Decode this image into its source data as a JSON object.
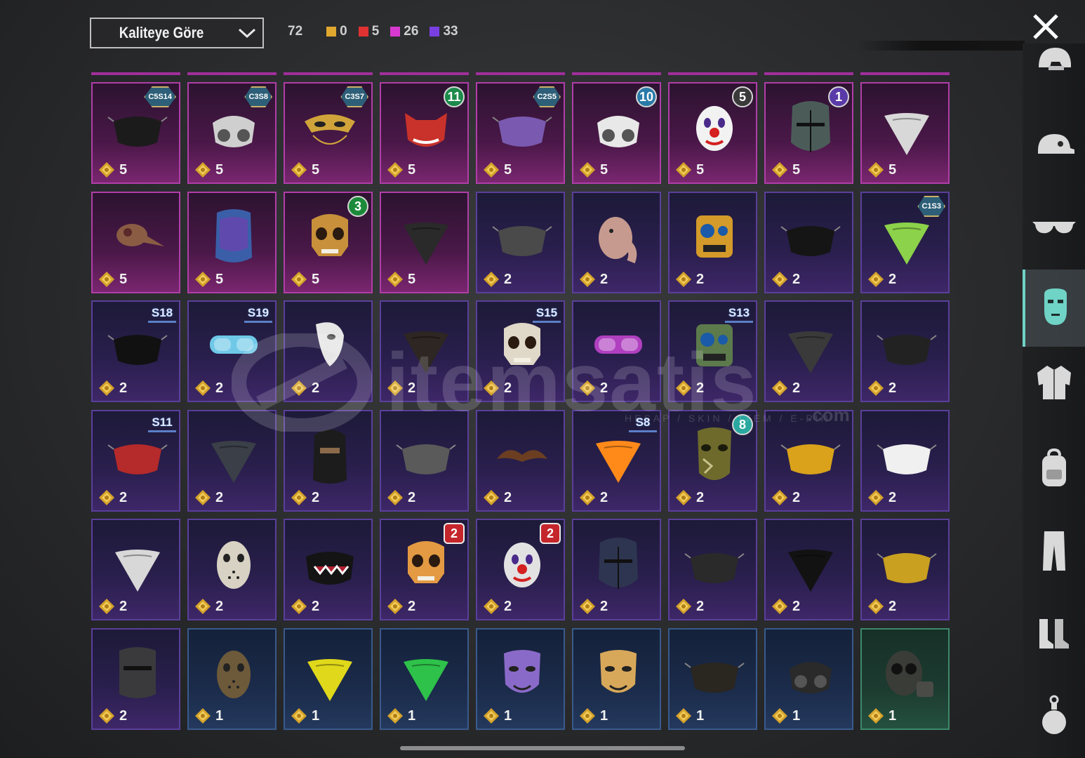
{
  "sort": {
    "label": "Kaliteye Göre"
  },
  "summary": {
    "total": "72",
    "counts": [
      {
        "color": "#e0a82e",
        "value": "0"
      },
      {
        "color": "#e03232",
        "value": "5"
      },
      {
        "color": "#d83ad0",
        "value": "26"
      },
      {
        "color": "#7a3fe0",
        "value": "33"
      }
    ]
  },
  "sidebar": {
    "tabs": [
      {
        "name": "helmet-icon",
        "active": false
      },
      {
        "name": "cap-icon",
        "active": false
      },
      {
        "name": "glasses-icon",
        "active": false
      },
      {
        "name": "mask-icon",
        "active": true
      },
      {
        "name": "jacket-icon",
        "active": false
      },
      {
        "name": "backpack-icon",
        "active": false
      },
      {
        "name": "pants-icon",
        "active": false
      },
      {
        "name": "boots-icon",
        "active": false
      },
      {
        "name": "grenade-icon",
        "active": false
      }
    ]
  },
  "watermark": {
    "text": "itemsatis",
    "sub": "HESAP / SKIN / ITEM / E-PIN",
    "domain": ".com"
  },
  "items": [
    {
      "rarity": "pink",
      "qty": "5",
      "badge": "C5S14",
      "badge_type": "hex",
      "art": "mask-cloth",
      "color": "#1b1b1b"
    },
    {
      "rarity": "pink",
      "qty": "5",
      "badge": "C3S8",
      "badge_type": "hex",
      "art": "respirator",
      "color": "#cfcfcf"
    },
    {
      "rarity": "pink",
      "qty": "5",
      "badge": "C3S7",
      "badge_type": "hex",
      "art": "venetian",
      "color": "#d0a43a"
    },
    {
      "rarity": "pink",
      "qty": "5",
      "badge": "11",
      "badge_type": "circle",
      "art": "oni",
      "color": "#c8322a"
    },
    {
      "rarity": "pink",
      "qty": "5",
      "badge": "C2S5",
      "badge_type": "hex",
      "art": "mask-cloth",
      "color": "#7a5ab0"
    },
    {
      "rarity": "pink",
      "qty": "5",
      "badge": "10",
      "badge_type": "circle",
      "art": "respirator",
      "color": "#e8e8e8"
    },
    {
      "rarity": "pink",
      "qty": "5",
      "badge": "5",
      "badge_type": "circle",
      "art": "clown",
      "color": "#f2f2f2"
    },
    {
      "rarity": "pink",
      "qty": "5",
      "badge": "1",
      "badge_type": "circle",
      "art": "knight",
      "color": "#4b5c58"
    },
    {
      "rarity": "pink",
      "qty": "5",
      "badge": "",
      "badge_type": "",
      "art": "bandana",
      "color": "#d8d8d8"
    },
    {
      "rarity": "pink",
      "qty": "5",
      "badge": "",
      "badge_type": "",
      "art": "plague",
      "color": "#8a5c44"
    },
    {
      "rarity": "pink",
      "qty": "5",
      "badge": "",
      "badge_type": "",
      "art": "visor",
      "color": "#3a5fa8"
    },
    {
      "rarity": "pink",
      "qty": "5",
      "badge": "3",
      "badge_type": "circle",
      "art": "skull",
      "color": "#c8903a"
    },
    {
      "rarity": "pink",
      "qty": "5",
      "badge": "",
      "badge_type": "",
      "art": "bandana",
      "color": "#2a2a2a"
    },
    {
      "rarity": "purple",
      "qty": "2",
      "badge": "",
      "badge_type": "",
      "art": "mask-cloth",
      "color": "#4a4a4a"
    },
    {
      "rarity": "purple",
      "qty": "2",
      "badge": "",
      "badge_type": "",
      "art": "animal",
      "color": "#c69a8e"
    },
    {
      "rarity": "purple",
      "qty": "2",
      "badge": "",
      "badge_type": "",
      "art": "robot",
      "color": "#d49a2a"
    },
    {
      "rarity": "purple",
      "qty": "2",
      "badge": "",
      "badge_type": "",
      "art": "mask-cloth",
      "color": "#151515"
    },
    {
      "rarity": "purple",
      "qty": "2",
      "badge": "C1S3",
      "badge_type": "hex",
      "art": "bandana",
      "color": "#8cd24a"
    },
    {
      "rarity": "purple",
      "qty": "2",
      "badge": "S18",
      "badge_type": "wing",
      "art": "mask-cloth",
      "color": "#111111"
    },
    {
      "rarity": "purple",
      "qty": "2",
      "badge": "S19",
      "badge_type": "wing",
      "art": "goggles",
      "color": "#6fc8e8"
    },
    {
      "rarity": "purple",
      "qty": "2",
      "badge": "",
      "badge_type": "",
      "art": "phantom",
      "color": "#e6e6e6"
    },
    {
      "rarity": "purple",
      "qty": "2",
      "badge": "",
      "badge_type": "",
      "art": "bandana",
      "color": "#2d2622"
    },
    {
      "rarity": "purple",
      "qty": "2",
      "badge": "S15",
      "badge_type": "wing",
      "art": "skull",
      "color": "#e0d8c8"
    },
    {
      "rarity": "purple",
      "qty": "2",
      "badge": "",
      "badge_type": "",
      "art": "goggles",
      "color": "#b040c0"
    },
    {
      "rarity": "purple",
      "qty": "2",
      "badge": "S13",
      "badge_type": "wing",
      "art": "robot",
      "color": "#5c7a4c"
    },
    {
      "rarity": "purple",
      "qty": "2",
      "badge": "",
      "badge_type": "",
      "art": "bandana",
      "color": "#3a3a3a"
    },
    {
      "rarity": "purple",
      "qty": "2",
      "badge": "",
      "badge_type": "",
      "art": "mask-cloth",
      "color": "#222222"
    },
    {
      "rarity": "purple",
      "qty": "2",
      "badge": "S11",
      "badge_type": "wing",
      "art": "mask-cloth",
      "color": "#b52a2a"
    },
    {
      "rarity": "purple",
      "qty": "2",
      "badge": "",
      "badge_type": "",
      "art": "bandana",
      "color": "#3a3f48"
    },
    {
      "rarity": "purple",
      "qty": "2",
      "badge": "",
      "badge_type": "",
      "art": "balaclava",
      "color": "#1c1c1c"
    },
    {
      "rarity": "purple",
      "qty": "2",
      "badge": "",
      "badge_type": "",
      "art": "mask-cloth",
      "color": "#5a5a5a"
    },
    {
      "rarity": "purple",
      "qty": "2",
      "badge": "",
      "badge_type": "",
      "art": "mustache",
      "color": "#6b3e22"
    },
    {
      "rarity": "purple",
      "qty": "2",
      "badge": "S8",
      "badge_type": "wing",
      "art": "bandana",
      "color": "#ff8a1a"
    },
    {
      "rarity": "purple",
      "qty": "2",
      "badge": "8",
      "badge_type": "circle",
      "art": "camo",
      "color": "#6e6a2c"
    },
    {
      "rarity": "purple",
      "qty": "2",
      "badge": "",
      "badge_type": "",
      "art": "mask-cloth",
      "color": "#d9a21a"
    },
    {
      "rarity": "purple",
      "qty": "2",
      "badge": "",
      "badge_type": "",
      "art": "mask-cloth",
      "color": "#f0f0f0"
    },
    {
      "rarity": "purple",
      "qty": "2",
      "badge": "",
      "badge_type": "",
      "art": "bandana",
      "color": "#d8d8d8"
    },
    {
      "rarity": "purple",
      "qty": "2",
      "badge": "",
      "badge_type": "",
      "art": "hockey",
      "color": "#d8d2c4"
    },
    {
      "rarity": "purple",
      "qty": "2",
      "badge": "",
      "badge_type": "",
      "art": "teeth",
      "color": "#141414"
    },
    {
      "rarity": "purple",
      "qty": "2",
      "badge": "2",
      "badge_type": "red2",
      "art": "skull",
      "color": "#e39a42"
    },
    {
      "rarity": "purple",
      "qty": "2",
      "badge": "2",
      "badge_type": "red2",
      "art": "clown",
      "color": "#e2e2e2"
    },
    {
      "rarity": "purple",
      "qty": "2",
      "badge": "",
      "badge_type": "",
      "art": "knight",
      "color": "#2e3550"
    },
    {
      "rarity": "purple",
      "qty": "2",
      "badge": "",
      "badge_type": "",
      "art": "mask-cloth",
      "color": "#2a2a2a"
    },
    {
      "rarity": "purple",
      "qty": "2",
      "badge": "",
      "badge_type": "",
      "art": "bandana",
      "color": "#121212"
    },
    {
      "rarity": "purple",
      "qty": "2",
      "badge": "",
      "badge_type": "",
      "art": "mask-cloth",
      "color": "#c9a020"
    },
    {
      "rarity": "purple",
      "qty": "2",
      "badge": "",
      "badge_type": "",
      "art": "riot",
      "color": "#3a3a3c"
    },
    {
      "rarity": "blue",
      "qty": "1",
      "badge": "",
      "badge_type": "",
      "art": "hockey",
      "color": "#6d5a3a"
    },
    {
      "rarity": "blue",
      "qty": "1",
      "badge": "",
      "badge_type": "",
      "art": "bandana",
      "color": "#e0d81a"
    },
    {
      "rarity": "blue",
      "qty": "1",
      "badge": "",
      "badge_type": "",
      "art": "bandana",
      "color": "#2ec24a"
    },
    {
      "rarity": "blue",
      "qty": "1",
      "badge": "",
      "badge_type": "",
      "art": "theater",
      "color": "#8a6ac8"
    },
    {
      "rarity": "blue",
      "qty": "1",
      "badge": "",
      "badge_type": "",
      "art": "theater",
      "color": "#d8a85a"
    },
    {
      "rarity": "blue",
      "qty": "1",
      "badge": "",
      "badge_type": "",
      "art": "mask-cloth",
      "color": "#2a2620"
    },
    {
      "rarity": "blue",
      "qty": "1",
      "badge": "",
      "badge_type": "",
      "art": "respirator",
      "color": "#2a2a2a"
    },
    {
      "rarity": "green",
      "qty": "1",
      "badge": "",
      "badge_type": "",
      "art": "gasmask",
      "color": "#3a3c38"
    }
  ]
}
